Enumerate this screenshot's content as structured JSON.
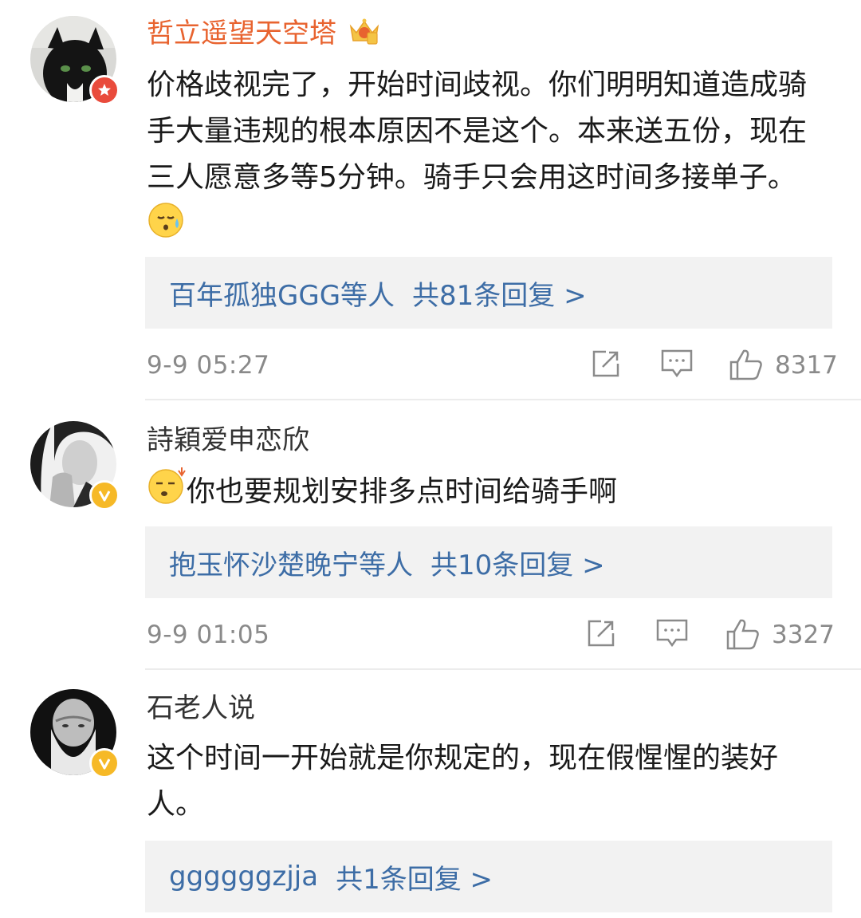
{
  "comments": [
    {
      "name": "哲立遥望天空塔",
      "name_color": "#e8632f",
      "text": "价格歧视完了，开始时间歧视。你们明明知道造成骑手大量违规的根本原因不是这个。本来送五份，现在三人愿意多等5分钟。骑手只会用这时间多接单子。",
      "reply_users": "百年孤独GGG等人",
      "reply_count": "共81条回复 >",
      "time": "9-9 05:27",
      "likes": "8317",
      "badge": "red-star-badge"
    },
    {
      "name": "詩穎爱申恋欣",
      "name_color": "#333333",
      "text": "你也要规划安排多点时间给骑手啊",
      "reply_users": "抱玉怀沙楚晚宁等人",
      "reply_count": "共10条回复 >",
      "time": "9-9 01:05",
      "likes": "3327",
      "badge": "yellow-v-badge"
    },
    {
      "name": "石老人说",
      "name_color": "#333333",
      "text": "这个时间一开始就是你规定的，现在假惺惺的装好人。",
      "reply_users": "ggggggzjja",
      "reply_count": "共1条回复 >",
      "badge": "yellow-v-badge"
    }
  ],
  "colors": {
    "link": "#3d6da6",
    "meta": "#8a8a8a",
    "reply_bg": "#f2f2f2"
  },
  "icons": [
    "share-icon",
    "comment-icon",
    "like-icon",
    "vip-crown-icon"
  ]
}
